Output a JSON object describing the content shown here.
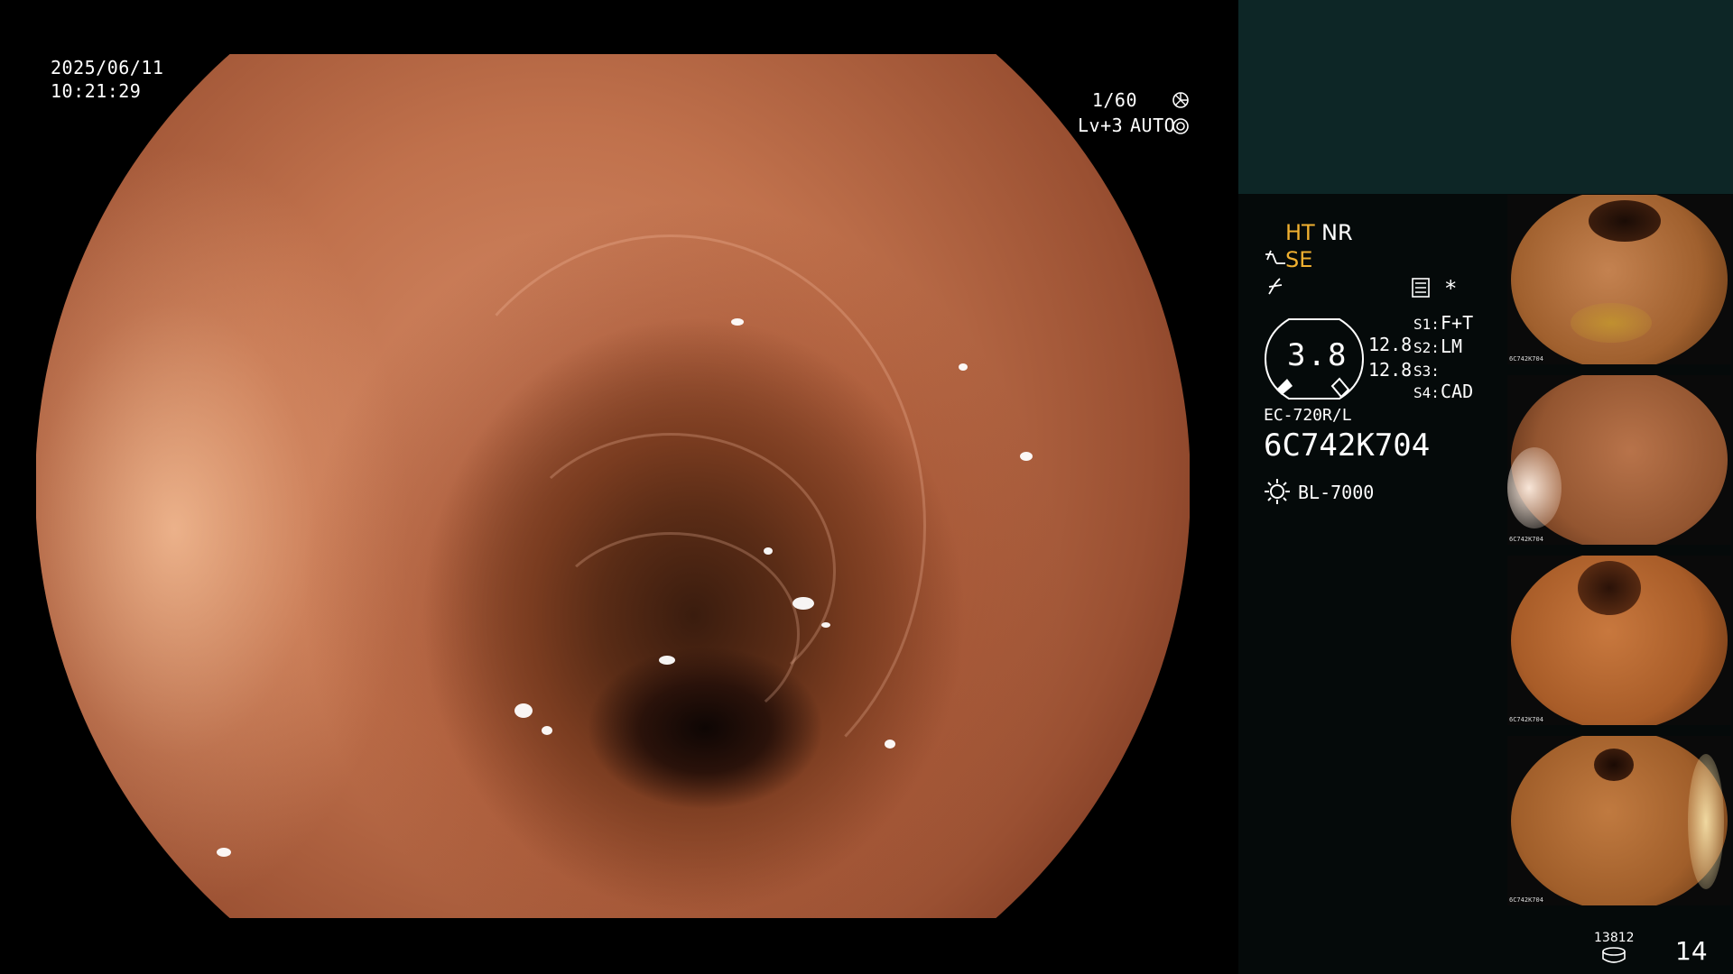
{
  "osd": {
    "date": "2025/06/11",
    "time": "10:21:29",
    "shutter": "1/60",
    "level": "Lv+3",
    "mode": "AUTO"
  },
  "panel": {
    "ht": "HT",
    "nr": "NR",
    "se": "SE",
    "gauge_value": "3.8",
    "gauge_side_a": "12.8",
    "gauge_side_b": "12.8",
    "asterisk": "*",
    "s1_key": "S1:",
    "s1_val": "F+T",
    "s2_key": "S2:",
    "s2_val": "LM",
    "s3_key": "S3:",
    "s3_val": "",
    "s4_key": "S4:",
    "s4_val": "CAD",
    "scope_model": "EC-720R/L",
    "scope_serial": "6C742K704",
    "light_source": "BL-7000",
    "storage_count": "13812",
    "image_count": "14"
  },
  "thumbnails": [
    {
      "label": "6C742K704"
    },
    {
      "label": "6C742K704"
    },
    {
      "label": "6C742K704"
    },
    {
      "label": "6C742K704"
    }
  ],
  "colors": {
    "accent_yellow": "#f0b030",
    "panel_top": "#0d2626",
    "panel_bg": "#050a0a"
  },
  "icons": [
    "shutter-icon",
    "auto-exposure-icon",
    "structure-enhance-icon",
    "freeze-icon",
    "settings-icon",
    "light-source-icon",
    "storage-icon"
  ]
}
